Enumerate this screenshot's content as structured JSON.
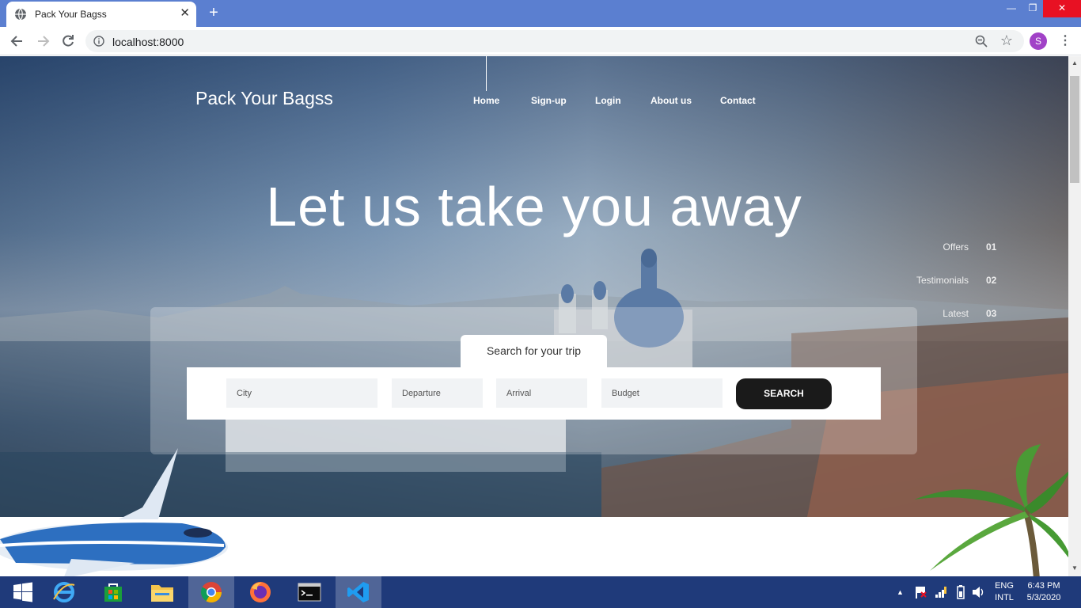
{
  "browser": {
    "tab_title": "Pack Your Bagss",
    "url": "localhost:8000",
    "profile_initial": "S"
  },
  "site": {
    "brand": "Pack Your Bagss",
    "nav": [
      "Home",
      "Sign-up",
      "Login",
      "About us",
      "Contact"
    ],
    "headline": "Let us take you away",
    "side_links": [
      {
        "label": "Offers",
        "num": "01"
      },
      {
        "label": "Testimonials",
        "num": "02"
      },
      {
        "label": "Latest",
        "num": "03"
      }
    ],
    "search": {
      "tab_label": "Search for your trip",
      "city": "City",
      "departure": "Departure",
      "arrival": "Arrival",
      "budget": "Budget",
      "button": "SEARCH"
    }
  },
  "taskbar": {
    "lang_top": "ENG",
    "lang_bottom": "INTL",
    "time": "6:43 PM",
    "date": "5/3/2020"
  },
  "colors": {
    "tab_strip": "#5b7fd0",
    "taskbar": "#1f3a7a",
    "search_button": "#1a1a1a",
    "avatar": "#a142c7"
  }
}
